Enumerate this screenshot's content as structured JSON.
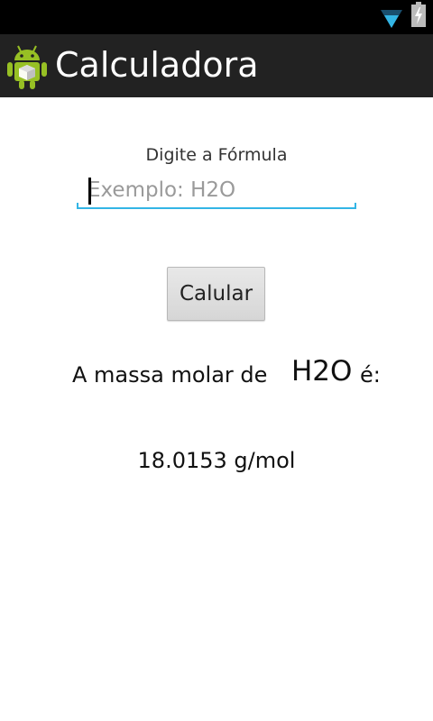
{
  "status_bar": {
    "icons": [
      "wifi-icon",
      "battery-charging-icon"
    ],
    "background": "#000000",
    "wifi_color": "#33b5e5"
  },
  "action_bar": {
    "app_icon": "android-robot-icon",
    "title": "Calculadora",
    "background": "#222222"
  },
  "form": {
    "label": "Digite a Fórmula",
    "input_value": "",
    "input_placeholder": "Exemplo: H2O",
    "accent_color": "#33b5e5",
    "button_label": "Calular"
  },
  "result": {
    "prefix": "A massa molar de",
    "formula": "H2O",
    "suffix": "é:",
    "value": "18.0153 g/mol"
  }
}
